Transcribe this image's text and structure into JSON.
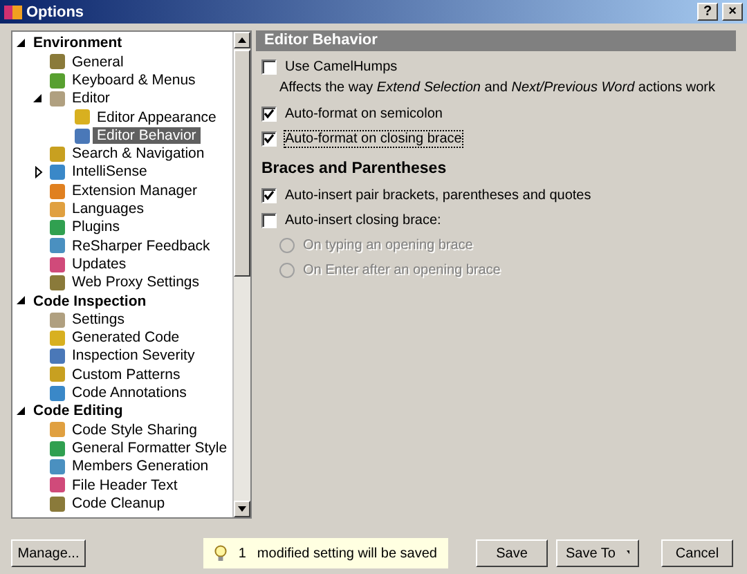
{
  "window": {
    "title": "Options",
    "buttons": [
      "?",
      "×"
    ]
  },
  "tree": [
    {
      "label": "Environment",
      "expanded": true,
      "selected": false,
      "children": [
        {
          "label": "General",
          "selected": false
        },
        {
          "label": "Keyboard & Menus",
          "selected": false
        },
        {
          "label": "Editor",
          "expanded": true,
          "selected": false,
          "children": [
            {
              "label": "Editor Appearance",
              "selected": false
            },
            {
              "label": "Editor Behavior",
              "selected": true
            }
          ]
        },
        {
          "label": "Search & Navigation",
          "selected": false
        },
        {
          "label": "IntelliSense",
          "expanded": false,
          "selected": false
        },
        {
          "label": "Extension Manager",
          "selected": false
        },
        {
          "label": "Languages",
          "selected": false
        },
        {
          "label": "Plugins",
          "selected": false
        },
        {
          "label": "ReSharper Feedback",
          "selected": false
        },
        {
          "label": "Updates",
          "selected": false
        },
        {
          "label": "Web Proxy Settings",
          "selected": false
        }
      ]
    },
    {
      "label": "Code Inspection",
      "expanded": true,
      "selected": false,
      "children": [
        {
          "label": "Settings",
          "selected": false
        },
        {
          "label": "Generated Code",
          "selected": false
        },
        {
          "label": "Inspection Severity",
          "selected": false
        },
        {
          "label": "Custom Patterns",
          "selected": false
        },
        {
          "label": "Code Annotations",
          "selected": false
        }
      ]
    },
    {
      "label": "Code Editing",
      "expanded": true,
      "selected": false,
      "children": [
        {
          "label": "Code Style Sharing",
          "selected": false
        },
        {
          "label": "General Formatter Style",
          "selected": false
        },
        {
          "label": "Members Generation",
          "selected": false
        },
        {
          "label": "File Header Text",
          "selected": false
        },
        {
          "label": "Code Cleanup",
          "selected": false
        }
      ]
    }
  ],
  "panel": {
    "title": "Editor Behavior",
    "options": [
      {
        "kind": "checkbox",
        "label": "Use CamelHumps",
        "checked": false,
        "focused": false
      },
      {
        "kind": "note",
        "text": "Affects the way *Extend Selection* and *Next/Previous Word* actions work"
      },
      {
        "kind": "checkbox",
        "label": "Auto-format on semicolon",
        "checked": true,
        "focused": false
      },
      {
        "kind": "checkbox",
        "label": "Auto-format on closing brace",
        "checked": true,
        "focused": true
      },
      {
        "kind": "heading",
        "text": "Braces and Parentheses"
      },
      {
        "kind": "checkbox",
        "label": "Auto-insert pair brackets, parentheses and quotes",
        "checked": true,
        "focused": false
      },
      {
        "kind": "checkbox",
        "label": "Auto-insert closing brace:",
        "checked": false,
        "focused": false
      },
      {
        "kind": "radio",
        "label": "On typing an opening brace",
        "selected": false,
        "disabled": true
      },
      {
        "kind": "radio",
        "label": "On Enter after an opening brace",
        "selected": false,
        "disabled": true
      }
    ]
  },
  "footer": {
    "manage": "Manage...",
    "notice": {
      "count": "1",
      "text": "modified setting will be saved"
    },
    "buttons": [
      {
        "label": "Save",
        "dropdown": false
      },
      {
        "label": "Save To",
        "dropdown": true
      },
      {
        "label": "Cancel",
        "dropdown": false
      }
    ]
  }
}
